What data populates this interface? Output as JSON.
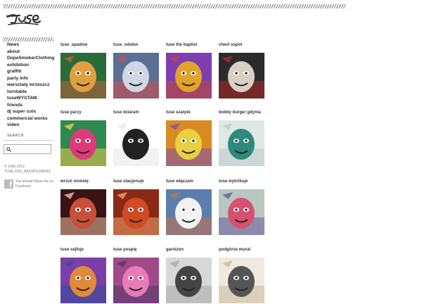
{
  "nav": [
    {
      "label": "News"
    },
    {
      "label": "about"
    },
    {
      "label": "DopeSmokerClothing"
    },
    {
      "label": "exhibition"
    },
    {
      "label": "graffiti"
    },
    {
      "label": "party info"
    },
    {
      "label": "warsztaty wrzeszcz"
    },
    {
      "label": "turntable"
    },
    {
      "label": "tuseWYSTAW"
    },
    {
      "label": "friends"
    },
    {
      "label": "dj super cuts"
    },
    {
      "label": "commercial works"
    },
    {
      "label": "video"
    }
  ],
  "search": {
    "label": "SEARCH",
    "value": ""
  },
  "footer": {
    "copyright_line1": "© 1995-2012",
    "copyright_line2": "TUSE DSC_BASSPUSHERS",
    "facebook_text": "You should follow me on Facebook"
  },
  "gallery": [
    {
      "caption": "tuse_spadnie",
      "palette": [
        "#2a6b3a",
        "#e0a040",
        "#c0603a"
      ],
      "icon": "grinning-face-mural"
    },
    {
      "caption": "tuse_odsłon",
      "palette": [
        "#5a6f95",
        "#cfd6e4",
        "#d84a4a"
      ],
      "icon": "wall-painting"
    },
    {
      "caption": "tuse the baptist",
      "palette": [
        "#7d3fb0",
        "#e0a428",
        "#c24a2e"
      ],
      "icon": "face-portrait"
    },
    {
      "caption": "chevi sopot",
      "palette": [
        "#2b2b2b",
        "#d9d0c3",
        "#b02828"
      ],
      "icon": "marilyn-portrait"
    },
    {
      "caption": "tuse parzy",
      "palette": [
        "#2e8a4f",
        "#e0397a",
        "#f2c94c"
      ],
      "icon": "cartoon-character"
    },
    {
      "caption": "tuse dziaram",
      "palette": [
        "#ffffff",
        "#222222",
        "#e8e8e8"
      ],
      "icon": "cartoon-sketch"
    },
    {
      "caption": "tuse szarpie",
      "palette": [
        "#d98a22",
        "#e8d040",
        "#7a4fb8"
      ],
      "icon": "cartoon-sticker"
    },
    {
      "caption": "bobby burger gdynia",
      "palette": [
        "#dfe9e4",
        "#2e8a7a",
        "#c0c8cc"
      ],
      "icon": "ship-mural"
    },
    {
      "caption": "wrzuć monetę",
      "palette": [
        "#3a1414",
        "#c8503a",
        "#f0c0a0"
      ],
      "icon": "woman-portrait"
    },
    {
      "caption": "tuse stacjonuje",
      "palette": [
        "#8a2a16",
        "#d04a24",
        "#f2a06a"
      ],
      "icon": "face-closeup"
    },
    {
      "caption": "tuse włączam",
      "palette": [
        "#5a7fae",
        "#f2f2f2",
        "#c8704a"
      ],
      "icon": "old-man-portrait"
    },
    {
      "caption": "tuse wykrikuje",
      "palette": [
        "#b8c8c0",
        "#d85070",
        "#6a5a9a"
      ],
      "icon": "screaming-face"
    },
    {
      "caption": "tuse sejfuje",
      "palette": [
        "#7a3fa8",
        "#e08a3a",
        "#2f4f9a"
      ],
      "icon": "glasses-face"
    },
    {
      "caption": "tuse pospię",
      "palette": [
        "#a04a8a",
        "#e87ab8",
        "#4a3a6a"
      ],
      "icon": "pink-face"
    },
    {
      "caption": "garnizon",
      "palette": [
        "#d8d8d8",
        "#444444",
        "#aaaaaa"
      ],
      "icon": "sketch-portrait"
    },
    {
      "caption": "podgórze mural",
      "palette": [
        "#efeae0",
        "#555555",
        "#c8b89a"
      ],
      "icon": "mural-faces"
    }
  ]
}
